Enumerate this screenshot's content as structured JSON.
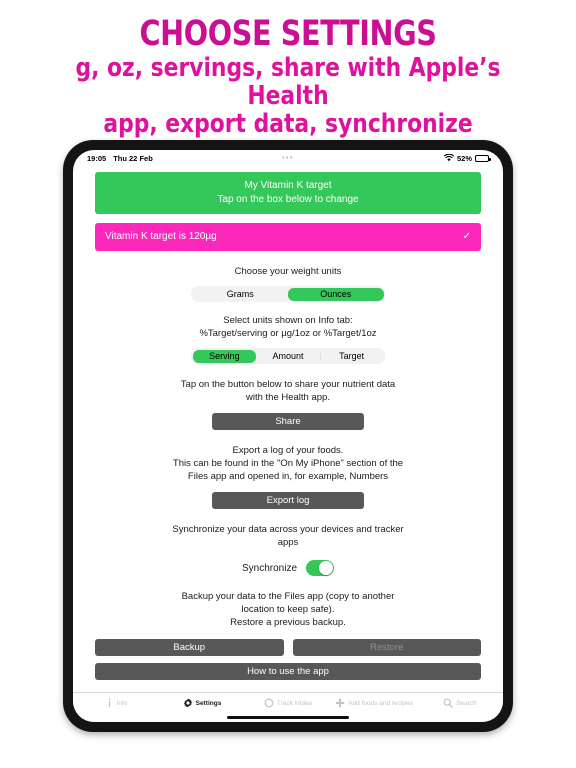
{
  "promo": {
    "line1": "CHOOSE SETTINGS",
    "line2": "g, oz, servings, share with Apple’s Health",
    "line3": "app, export data, synchronize",
    "color_heading": "#cc0e92",
    "color_sub": "#e0119c"
  },
  "statusbar": {
    "time": "19:05",
    "date": "Thu 22 Feb",
    "center_dots": "•••",
    "battery_percent": "52%",
    "wifi_icon": "wifi-icon",
    "battery_icon": "battery-icon"
  },
  "target": {
    "header_line1": "My Vitamin K target",
    "header_line2": "Tap on the box below to change",
    "row_label": "Vitamin K target is 120µg",
    "row_check": "✓",
    "header_color": "#34c759",
    "row_color": "#fb28bb"
  },
  "weight_units": {
    "label": "Choose your weight units",
    "options": [
      "Grams",
      "Ounces"
    ],
    "selected": "Ounces"
  },
  "info_units": {
    "label_line1": "Select units shown on Info tab:",
    "label_line2": "%Target/serving or µg/1oz or %Target/1oz",
    "options": [
      "Serving",
      "Amount",
      "Target"
    ],
    "selected": "Serving"
  },
  "share": {
    "label_line1": "Tap on the button below to share your nutrient data",
    "label_line2": "with the Health app.",
    "button": "Share"
  },
  "export": {
    "label_line1": "Export a log of your foods.",
    "label_line2": "This can be found in the \"On My iPhone\" section of the",
    "label_line3": "Files app and opened in, for example, Numbers",
    "button": "Export log"
  },
  "synchronize": {
    "label_line1": "Synchronize your data across your devices and tracker",
    "label_line2": "apps",
    "toggle_label": "Synchronize",
    "toggle_state": "on"
  },
  "backup": {
    "label_line1": "Backup your data to the Files app (copy to another",
    "label_line2": "location to keep safe).",
    "label_line3": "Restore a previous backup.",
    "backup_button": "Backup",
    "restore_button": "Restore",
    "help_button": "How to use the app"
  },
  "tabbar": {
    "tabs": [
      {
        "label": "Info",
        "icon": "info-icon",
        "active": false
      },
      {
        "label": "Settings",
        "icon": "gear-icon",
        "active": true
      },
      {
        "label": "Track intake",
        "icon": "circle-icon",
        "active": false
      },
      {
        "label": "Add foods and recipes",
        "icon": "plus-icon",
        "active": false
      },
      {
        "label": "Search",
        "icon": "search-icon",
        "active": false
      }
    ]
  }
}
